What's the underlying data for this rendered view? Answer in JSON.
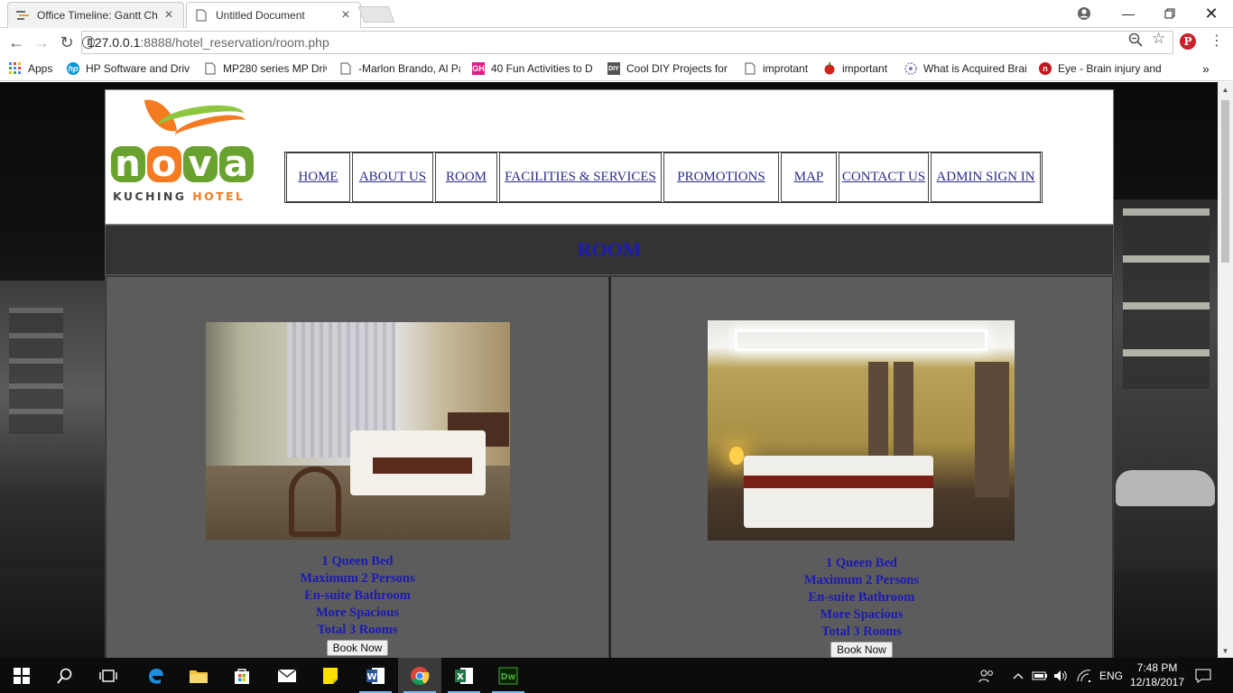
{
  "browser": {
    "tabs": [
      {
        "title": "Office Timeline: Gantt Ch",
        "icon": "office-timeline-icon",
        "active": false
      },
      {
        "title": "Untitled Document",
        "icon": "document-icon",
        "active": true
      }
    ],
    "address": {
      "host": "127.0.0.1",
      "path": ":8888/hotel_reservation/room.php"
    },
    "bookmarks": [
      {
        "label": "Apps",
        "icon": "apps-grid-icon"
      },
      {
        "label": "HP Software and Driv",
        "icon": "hp-icon"
      },
      {
        "label": "MP280 series MP Driv",
        "icon": "page-icon"
      },
      {
        "label": "-Marlon Brando, Al Pa",
        "icon": "page-icon"
      },
      {
        "label": "40 Fun Activities to D",
        "icon": "gh-icon"
      },
      {
        "label": "Cool DIY Projects for",
        "icon": "diy-icon"
      },
      {
        "label": "improtant",
        "icon": "page-icon"
      },
      {
        "label": "important",
        "icon": "apple-icon"
      },
      {
        "label": "What is Acquired Brai",
        "icon": "brain-icon"
      },
      {
        "label": "Eye - Brain injury and",
        "icon": "eye-icon"
      }
    ],
    "bookmarks_overflow": "»"
  },
  "site": {
    "logo": {
      "word": [
        "n",
        "o",
        "v",
        "a"
      ],
      "sub_left": "KUCHING",
      "sub_right": "HOTEL"
    },
    "nav": [
      "HOME",
      "ABOUT US",
      "ROOM",
      "FACILITIES & SERVICES",
      "PROMOTIONS",
      "MAP",
      "CONTACT US",
      "ADMIN SIGN IN"
    ],
    "page_title": "ROOM",
    "rooms": [
      {
        "features": [
          "1 Queen Bed",
          "Maximum 2 Persons",
          "En-suite Bathroom",
          "More Spacious",
          "Total 3 Rooms"
        ],
        "button": "Book Now"
      },
      {
        "features": [
          "1 Queen Bed",
          "Maximum 2 Persons",
          "En-suite Bathroom",
          "More Spacious",
          "Total 3 Rooms"
        ],
        "button": "Book Now"
      }
    ]
  },
  "taskbar": {
    "apps": [
      "edge-icon",
      "file-explorer-icon",
      "store-icon",
      "mail-icon",
      "sticky-notes-icon",
      "word-icon",
      "chrome-icon",
      "excel-icon",
      "dreamweaver-icon"
    ],
    "language": "ENG",
    "time": "7:48 PM",
    "date": "12/18/2017"
  }
}
